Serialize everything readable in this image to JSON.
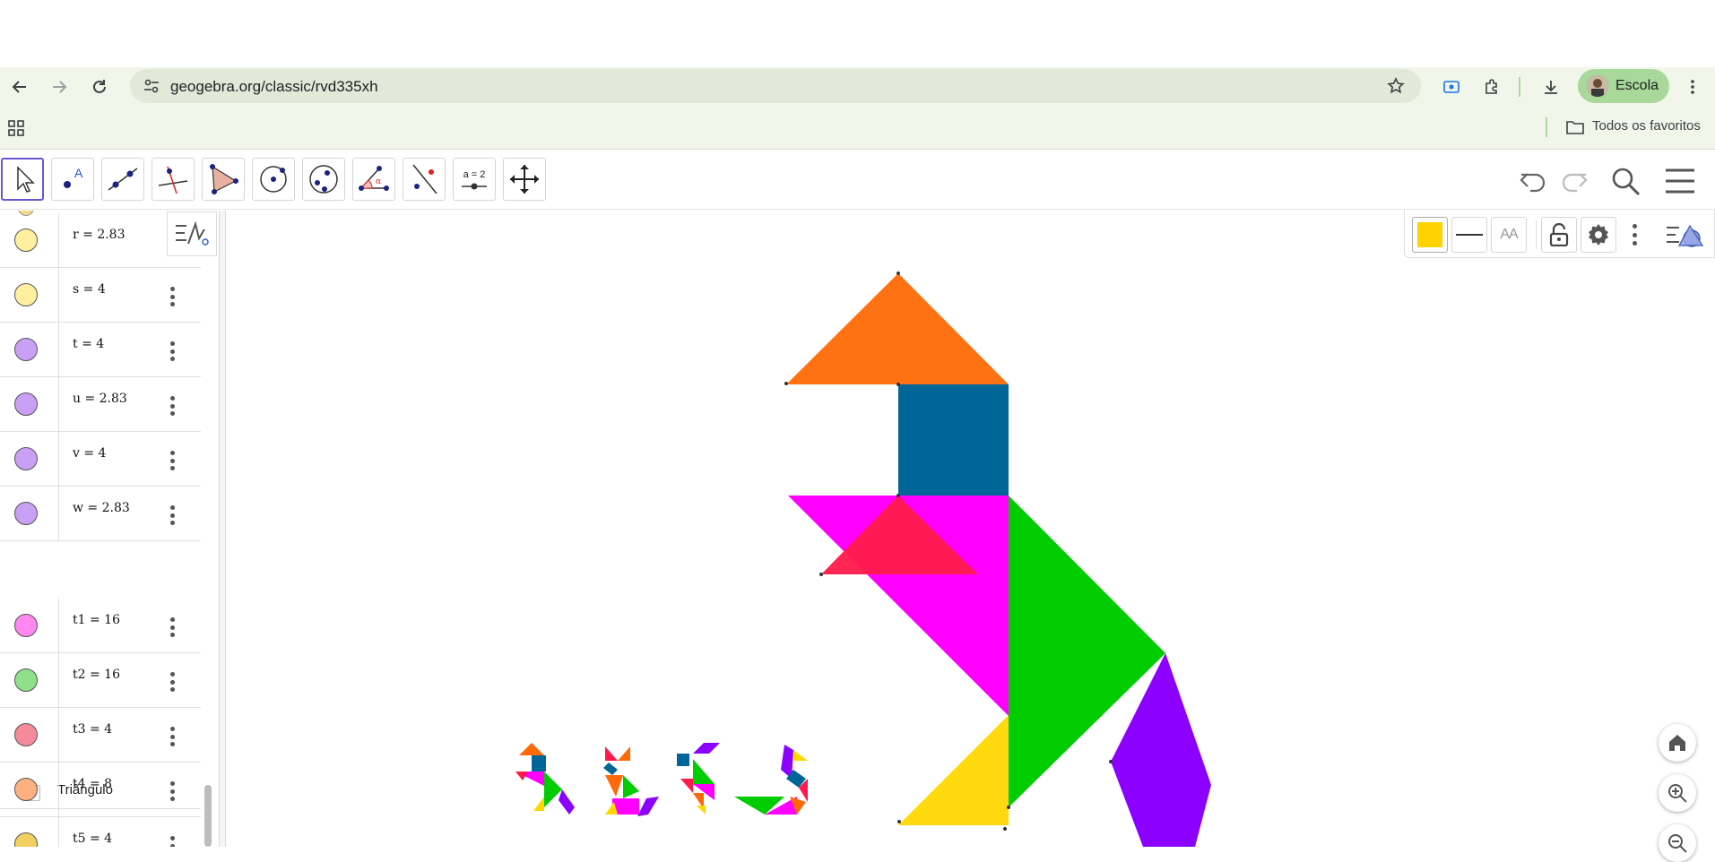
{
  "browser": {
    "url": "geogebra.org/classic/rvd335xh",
    "profile_name": "Escola",
    "bookmarks_label": "Todos os favoritos"
  },
  "toolbar": {
    "tools": [
      {
        "name": "move-tool",
        "selected": true
      },
      {
        "name": "point-tool"
      },
      {
        "name": "line-tool"
      },
      {
        "name": "perpendicular-line-tool"
      },
      {
        "name": "polygon-tool"
      },
      {
        "name": "circle-center-point-tool"
      },
      {
        "name": "ellipse-tool"
      },
      {
        "name": "angle-tool"
      },
      {
        "name": "reflect-tool"
      },
      {
        "name": "slider-tool",
        "label": "a = 2"
      },
      {
        "name": "move-graphics-view-tool"
      }
    ]
  },
  "algebra": {
    "rows_before": [
      {
        "expr": "r = 2.83",
        "color": "#fff0a0"
      },
      {
        "expr": "s = 4",
        "color": "#fff0a0"
      },
      {
        "expr": "t = 4",
        "color": "#c9a0f5"
      },
      {
        "expr": "u = 2.83",
        "color": "#c9a0f5"
      },
      {
        "expr": "v = 4",
        "color": "#c9a0f5"
      },
      {
        "expr": "w = 2.83",
        "color": "#c9a0f5"
      }
    ],
    "group_label": "Triângulo",
    "rows_after": [
      {
        "expr": "t1 = 16",
        "color": "#ff88f0"
      },
      {
        "expr": "t2 = 16",
        "color": "#8fe08a"
      },
      {
        "expr": "t3 = 4",
        "color": "#f58a9a"
      },
      {
        "expr": "t4 = 8",
        "color": "#ffb080"
      },
      {
        "expr": "t5 = 4",
        "color": "#f0d060"
      }
    ]
  },
  "style_bar": {
    "color_swatch": "#ffd200",
    "font_button_label": "AA"
  },
  "colors": {
    "orange": "#ff6a06",
    "blue": "#006699",
    "magenta": "#ff00ff",
    "red": "#ff1a4b",
    "green": "#00cc00",
    "yellow": "#ffd700",
    "purple": "#8c00ff"
  }
}
